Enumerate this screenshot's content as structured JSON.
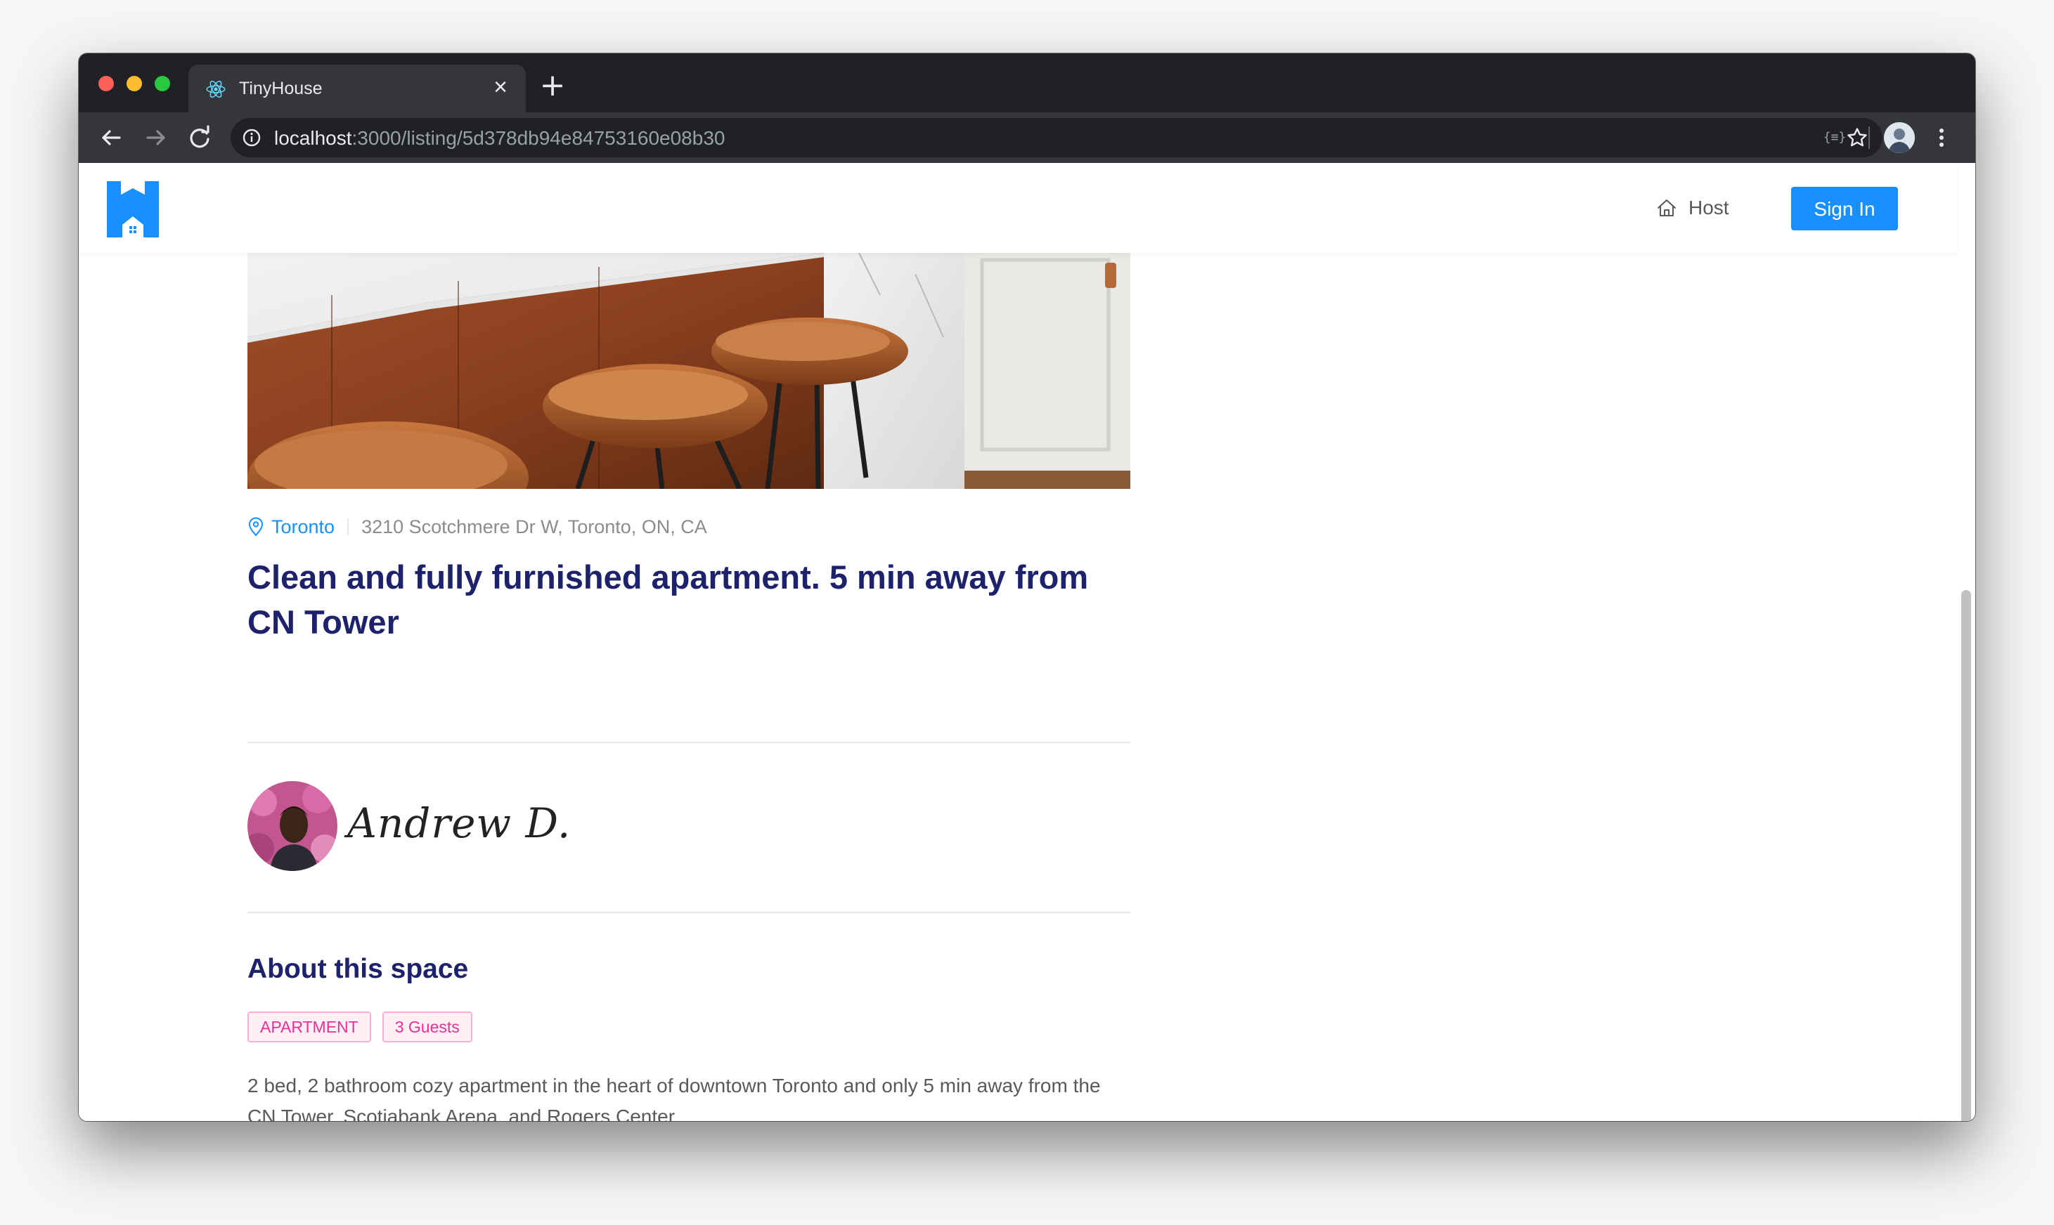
{
  "browser": {
    "tab": {
      "title": "TinyHouse",
      "favicon": "react-icon"
    },
    "new_tab_label": "+",
    "close_label": "×",
    "address_bar": {
      "host": "localhost",
      "path": ":3000/listing/5d378db94e84753160e08b30"
    },
    "extension_label": "{≡}"
  },
  "header": {
    "logo": "tinyhouse-logo-icon",
    "host_label": "Host",
    "sign_in_label": "Sign In",
    "accent_color": "#1890ff"
  },
  "listing": {
    "city": "Toronto",
    "address": "3210 Scotchmere Dr W, Toronto, ON, CA",
    "title": "Clean and fully furnished apartment. 5 min away from CN Tower",
    "host_name": "Andrew D.",
    "about_title": "About this space",
    "tags": [
      "APARTMENT",
      "3 Guests"
    ],
    "description": "2 bed, 2 bathroom cozy apartment in the heart of downtown Toronto and only 5 min away from the CN Tower, Scotiabank Arena, and Rogers Center.",
    "title_color": "#1d226c",
    "tag_color": "#eb2f96"
  }
}
